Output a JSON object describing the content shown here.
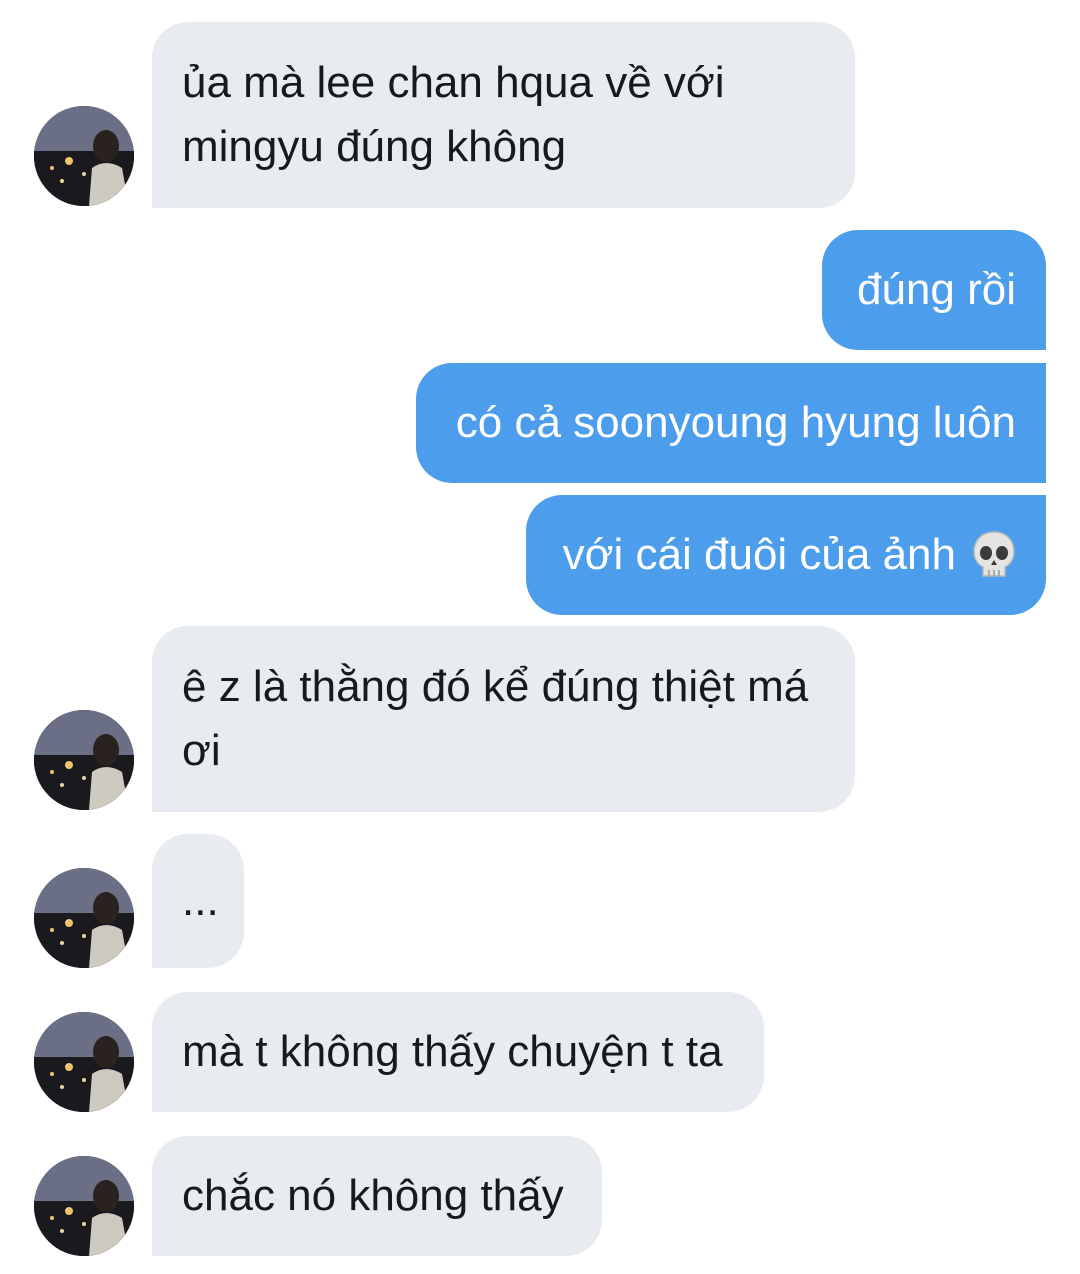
{
  "messages": [
    {
      "direction": "incoming",
      "text": "ủa mà lee chan hqua về với mingyu đúng không",
      "avatar": true
    },
    {
      "direction": "outgoing",
      "text": "đúng rồi"
    },
    {
      "direction": "outgoing",
      "text": "có cả soonyoung hyung luôn"
    },
    {
      "direction": "outgoing",
      "text": "với cái đuôi của ảnh",
      "emoji": "skull-emoji"
    },
    {
      "direction": "incoming",
      "text": "ê z là thằng đó kể đúng thiệt má ơi",
      "avatar": true
    },
    {
      "direction": "incoming",
      "text": "...",
      "avatar": true
    },
    {
      "direction": "incoming",
      "text": "mà t không thấy chuyện t ta",
      "avatar": true
    },
    {
      "direction": "incoming",
      "text": "chắc nó không thấy",
      "avatar": true
    }
  ],
  "colors": {
    "incoming_bubble": "#e8ecf1",
    "outgoing_bubble": "#4c9deb",
    "incoming_text": "#17191c",
    "outgoing_text": "#ffffff"
  }
}
